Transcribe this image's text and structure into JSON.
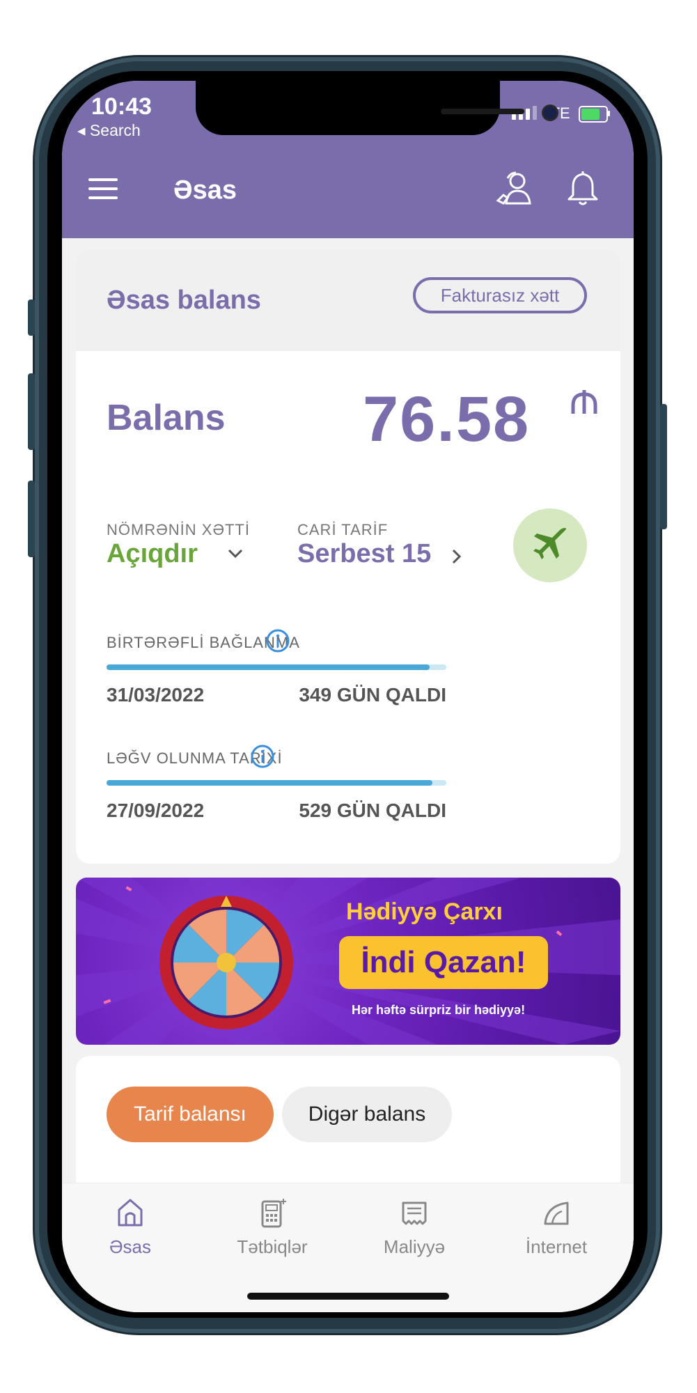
{
  "status_bar": {
    "time": "10:43",
    "back_label": "◂ Search",
    "network": "LTE"
  },
  "header": {
    "title": "Əsas"
  },
  "balance_card": {
    "title": "Əsas balans",
    "fakturasiz_label": "Fakturasız xətt",
    "balance_label": "Balans",
    "balance_value": "76.58",
    "line_status_label": "NÖMRƏNİN XƏTTİ",
    "line_status_value": "Açıqdır",
    "tariff_label": "CARİ TARİF",
    "tariff_value": "Serbest 15",
    "conditions": [
      {
        "label": "BİRTƏRƏFLİ BAĞLANMA",
        "date": "31/03/2022",
        "days_left": "349 GÜN QALDI",
        "progress_percent": 95
      },
      {
        "label": "LƏĞV OLUNMA TARİXİ",
        "date": "27/09/2022",
        "days_left": "529 GÜN QALDI",
        "progress_percent": 96
      }
    ]
  },
  "banner": {
    "title": "Hədiyyə Çarxı",
    "cta": "İndi Qazan!",
    "subtitle": "Hər həftə sürpriz bir hədiyyə!"
  },
  "balance_tabs": {
    "active": "Tarif balansı",
    "inactive": "Digər balans"
  },
  "bottom_nav": {
    "items": [
      {
        "label": "Əsas",
        "icon": "home-icon"
      },
      {
        "label": "Tətbiqlər",
        "icon": "apps-icon"
      },
      {
        "label": "Maliyyə",
        "icon": "finance-icon"
      },
      {
        "label": "İnternet",
        "icon": "internet-icon"
      }
    ]
  },
  "colors": {
    "brand_purple": "#7b6dab",
    "line_open_green": "#6aa53a",
    "tab_active_orange": "#e8854c",
    "progress_blue": "#4aa8d6"
  }
}
